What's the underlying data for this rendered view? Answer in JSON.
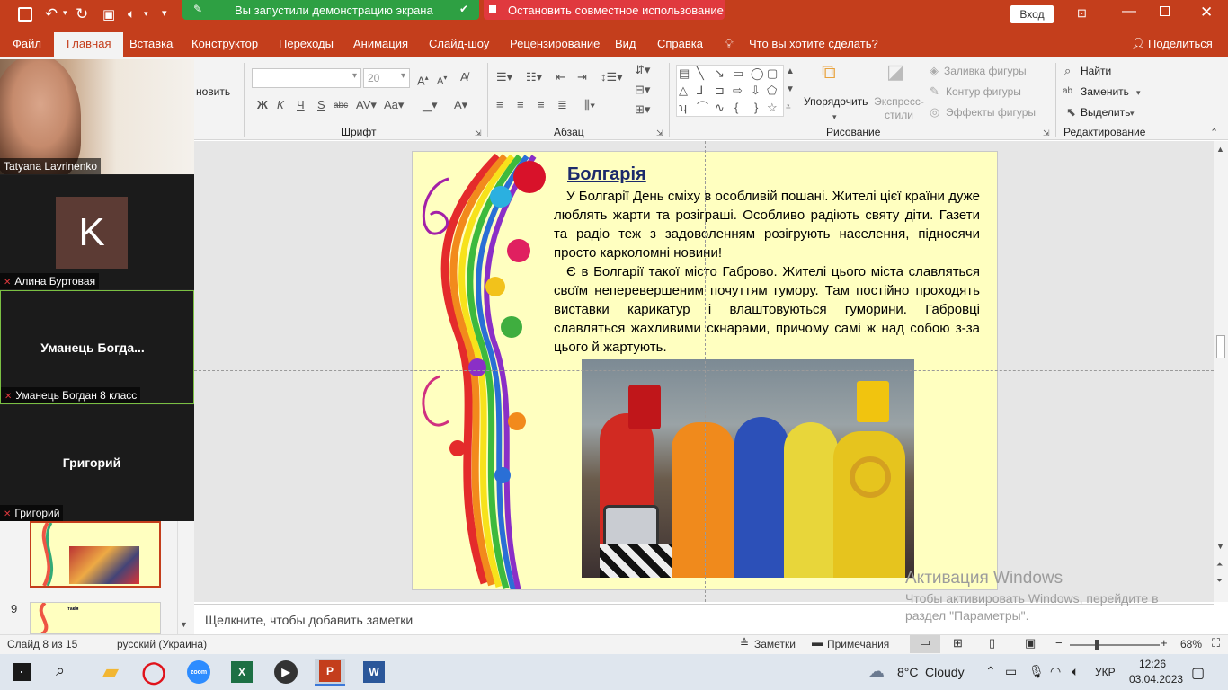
{
  "title_bar": {
    "sharing_status": "Вы запустили демонстрацию экрана",
    "stop_sharing": "Остановить совместное использование",
    "signin": "Вход"
  },
  "ribbon_tabs": [
    "Файл",
    "Главная",
    "Вставка",
    "Конструктор",
    "Переходы",
    "Анимация",
    "Слайд-шоу",
    "Рецензирование",
    "Вид",
    "Справка"
  ],
  "tell_me": "Что вы хотите сделать?",
  "share": "Поделиться",
  "ribbon": {
    "clipboard_partial_1": "новить",
    "font_size": "20",
    "groups": {
      "font": "Шрифт",
      "paragraph": "Абзац",
      "drawing": "Рисование",
      "editing": "Редактирование"
    },
    "arrange": "Упорядочить",
    "quick_styles": "Экспресс-стили",
    "shape_fill": "Заливка фигуры",
    "shape_outline": "Контур фигуры",
    "shape_effects": "Эффекты фигуры",
    "find": "Найти",
    "replace": "Заменить",
    "select": "Выделить"
  },
  "zoom_panel": {
    "participants": [
      {
        "name": "Tatyana Lavrinenko",
        "type": "video"
      },
      {
        "name": "Алина Буртовая",
        "type": "avatar",
        "initial": "K",
        "muted": true
      },
      {
        "name": "Уманець  Богда...",
        "caption": "Уманець Богдан 8 класс",
        "type": "name",
        "muted": true,
        "active": true
      },
      {
        "name": "Григорий",
        "caption": "Григорий",
        "type": "name",
        "muted": true
      }
    ]
  },
  "thumbnails": [
    {
      "number": "9",
      "title": "Ітакія"
    }
  ],
  "slide": {
    "title": "Болгарія",
    "paragraph1": "У Болгарії День сміху в особливій пошані. Жителі цієї країни дуже люблять жарти та розіграші. Особливо радіють святу діти. Газети та радіо теж з задоволенням розігрують населення, підносячи просто карколомні новини!",
    "paragraph2": "Є в Болгарії такої місто Габрово. Жителі цього міста славляться своїм неперевершеним почуттям гумору. Там постійно проходять виставки карикатур і влаштовуються гуморини. Габровці славляться жахливими скнарами, причому самі ж над собою з-за цього й жартують."
  },
  "notes_placeholder": "Щелкните, чтобы добавить заметки",
  "watermark": {
    "title": "Активация Windows",
    "line1": "Чтобы активировать Windows, перейдите в",
    "line2": "раздел \"Параметры\"."
  },
  "status_bar": {
    "slide": "Слайд 8 из 15",
    "language": "русский (Украина)",
    "notes": "Заметки",
    "comments": "Примечания",
    "zoom": "68%"
  },
  "taskbar": {
    "weather_temp": "8°C",
    "weather_desc": "Cloudy",
    "language": "УКР",
    "time": "12:26",
    "date": "03.04.2023"
  },
  "colors": {
    "accent": "#c43e1c",
    "share_green": "#2ea043",
    "stop_red": "#e0393e",
    "slide_bg": "#ffffc0"
  }
}
